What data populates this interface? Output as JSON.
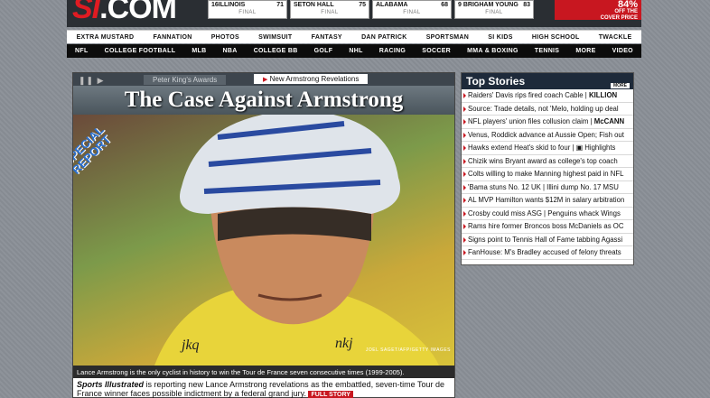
{
  "brand": {
    "logo_prefix": "SI",
    "logo_suffix": ".COM"
  },
  "scores": [
    {
      "team": "ILLINOIS",
      "rank": "16",
      "score": "71",
      "status": "FINAL"
    },
    {
      "team": "SETON HALL",
      "rank": "",
      "score": "75",
      "status": "FINAL"
    },
    {
      "team": "ALABAMA",
      "rank": "",
      "score": "68",
      "status": "FINAL"
    },
    {
      "team": "BRIGHAM YOUNG",
      "rank": "9",
      "score": "83",
      "status": "FINAL"
    }
  ],
  "promo": {
    "big": "84%",
    "line1": "OFF THE",
    "line2": "COVER PRICE"
  },
  "nav_primary": [
    "EXTRA MUSTARD",
    "FANNATION",
    "PHOTOS",
    "SWIMSUIT",
    "FANTASY",
    "DAN PATRICK",
    "SPORTSMAN",
    "SI KIDS",
    "HIGH SCHOOL",
    "TWACKLE"
  ],
  "nav_secondary": [
    "NFL",
    "COLLEGE FOOTBALL",
    "MLB",
    "NBA",
    "COLLEGE BB",
    "GOLF",
    "NHL",
    "RACING",
    "SOCCER",
    "MMA & BOXING",
    "TENNIS",
    "MORE",
    "VIDEO"
  ],
  "main_story": {
    "tab_inactive": "Peter King's Awards",
    "tab_active": "New Armstrong Revelations",
    "title": "The Case Against Armstrong",
    "special_line1": "SPECIAL",
    "special_line2": "REPORT",
    "credit": "JOEL SAGET/AFP/GETTY IMAGES",
    "caption": "Lance Armstrong is the only cyclist in history to win the Tour de France seven consecutive times (1999-2005).",
    "teaser_lead": "Sports Illustrated",
    "teaser_body": " is reporting new Lance Armstrong revelations as the embattled, seven-time Tour de France winner faces possible indictment by a federal grand jury.",
    "teaser_btn": "FULL STORY"
  },
  "top_stories": {
    "title": "Top Stories",
    "more": "MORE",
    "items": [
      {
        "text": "Raiders' Davis rips fired coach Cable",
        "tag": "KILLION"
      },
      {
        "text": "Source: Trade details, not 'Melo, holding up deal",
        "tag": ""
      },
      {
        "text": "NFL players' union files collusion claim",
        "tag": "McCANN"
      },
      {
        "text": "Venus, Roddick advance at Aussie Open; Fish out",
        "tag": ""
      },
      {
        "text": "Hawks extend Heat's skid to four",
        "tag": "Highlights"
      },
      {
        "text": "Chizik wins Bryant award as college's top coach",
        "tag": ""
      },
      {
        "text": "Colts willing to make Manning highest paid in NFL",
        "tag": ""
      },
      {
        "text": "'Bama stuns No. 12 UK | Illini dump No. 17 MSU",
        "tag": ""
      },
      {
        "text": "AL MVP Hamilton wants $12M in salary arbitration",
        "tag": ""
      },
      {
        "text": "Crosby could miss ASG | Penguins whack Wings",
        "tag": ""
      },
      {
        "text": "Rams hire former Broncos boss McDaniels as OC",
        "tag": ""
      },
      {
        "text": "Signs point to Tennis Hall of Fame tabbing Agassi",
        "tag": ""
      },
      {
        "text": "FanHouse: M's Bradley accused of felony threats",
        "tag": ""
      }
    ]
  }
}
